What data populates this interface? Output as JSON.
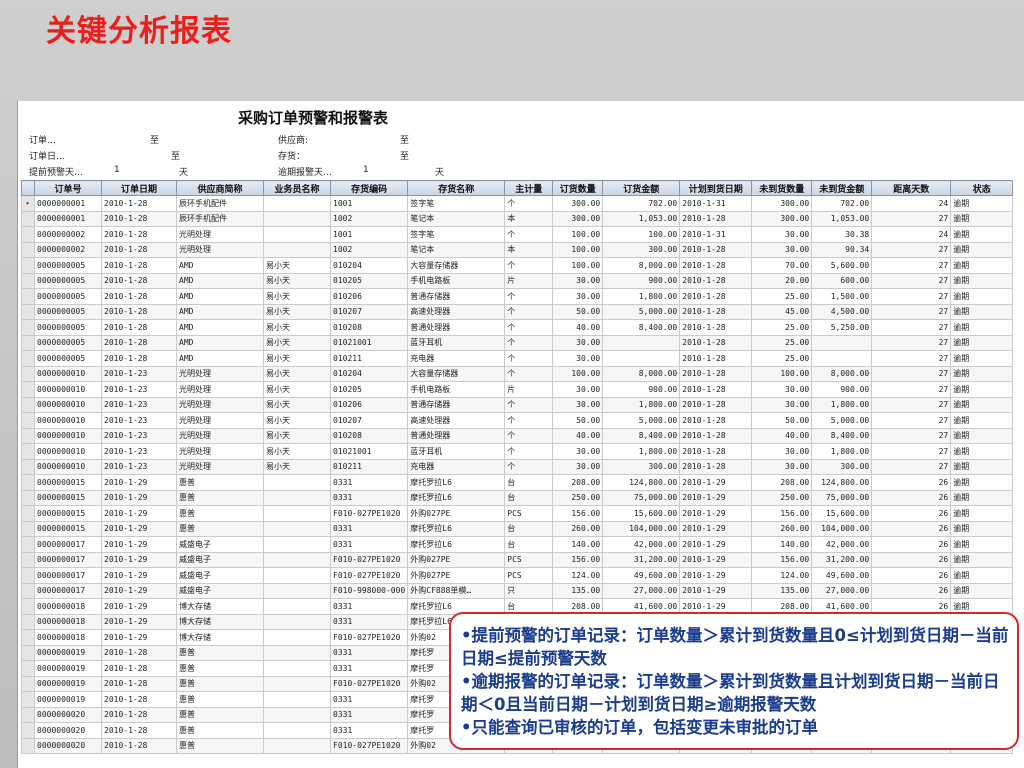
{
  "slide": {
    "title": "关键分析报表"
  },
  "report": {
    "title": "采购订单预警和报警表",
    "filters": {
      "order_no_label": "订单…",
      "order_no_to": "至",
      "supplier_label": "供应商:",
      "supplier_to": "至",
      "order_date_label": "订单日…",
      "order_date_to": "至",
      "inventory_label": "存货：",
      "inventory_to": "至",
      "advance_label": "提前预警天…",
      "advance_value": "1",
      "advance_unit": "天",
      "overdue_label": "逾期报警天…",
      "overdue_value": "1",
      "overdue_unit": "天"
    },
    "columns": [
      "",
      "订单号",
      "订单日期",
      "供应商简称",
      "业务员名称",
      "存货编码",
      "存货名称",
      "主计量",
      "订货数量",
      "订货金额",
      "计划到货日期",
      "未到货数量",
      "未到货金额",
      "距离天数",
      "状态"
    ],
    "rows": [
      [
        "▸",
        "0000000001",
        "2010-1-28",
        "辰环手机配件",
        "",
        "1001",
        "签字笔",
        "个",
        "300.00",
        "702.00",
        "2010-1-31",
        "300.00",
        "702.00",
        "24",
        "逾期"
      ],
      [
        "",
        "0000000001",
        "2010-1-28",
        "辰环手机配件",
        "",
        "1002",
        "笔记本",
        "本",
        "300.00",
        "1,053.00",
        "2010-1-28",
        "300.00",
        "1,053.00",
        "27",
        "逾期"
      ],
      [
        "",
        "0000000002",
        "2010-1-28",
        "光明处理",
        "",
        "1001",
        "签字笔",
        "个",
        "100.00",
        "100.00",
        "2010-1-31",
        "30.00",
        "30.38",
        "24",
        "逾期"
      ],
      [
        "",
        "0000000002",
        "2010-1-28",
        "光明处理",
        "",
        "1002",
        "笔记本",
        "本",
        "100.00",
        "300.00",
        "2010-1-28",
        "30.00",
        "90.34",
        "27",
        "逾期"
      ],
      [
        "",
        "0000000005",
        "2010-1-28",
        "AMD",
        "易小天",
        "010204",
        "大容量存储器",
        "个",
        "100.00",
        "8,000.00",
        "2010-1-28",
        "70.00",
        "5,600.00",
        "27",
        "逾期"
      ],
      [
        "",
        "0000000005",
        "2010-1-28",
        "AMD",
        "易小天",
        "010205",
        "手机电路板",
        "片",
        "30.00",
        "900.00",
        "2010-1-28",
        "20.00",
        "600.00",
        "27",
        "逾期"
      ],
      [
        "",
        "0000000005",
        "2010-1-28",
        "AMD",
        "易小天",
        "010206",
        "普通存储器",
        "个",
        "30.00",
        "1,800.00",
        "2010-1-28",
        "25.00",
        "1,500.00",
        "27",
        "逾期"
      ],
      [
        "",
        "0000000005",
        "2010-1-28",
        "AMD",
        "易小天",
        "010207",
        "高速处理器",
        "个",
        "50.00",
        "5,000.00",
        "2010-1-28",
        "45.00",
        "4,500.00",
        "27",
        "逾期"
      ],
      [
        "",
        "0000000005",
        "2010-1-28",
        "AMD",
        "易小天",
        "010208",
        "普通处理器",
        "个",
        "40.00",
        "8,400.00",
        "2010-1-28",
        "25.00",
        "5,250.00",
        "27",
        "逾期"
      ],
      [
        "",
        "0000000005",
        "2010-1-28",
        "AMD",
        "易小天",
        "01021001",
        "蓝牙耳机",
        "个",
        "30.00",
        "",
        "2010-1-28",
        "25.00",
        "",
        "27",
        "逾期"
      ],
      [
        "",
        "0000000005",
        "2010-1-28",
        "AMD",
        "易小天",
        "010211",
        "充电器",
        "个",
        "30.00",
        "",
        "2010-1-28",
        "25.00",
        "",
        "27",
        "逾期"
      ],
      [
        "",
        "0000000010",
        "2010-1-23",
        "光明处理",
        "易小天",
        "010204",
        "大容量存储器",
        "个",
        "100.00",
        "8,000.00",
        "2010-1-28",
        "100.00",
        "8,000.00",
        "27",
        "逾期"
      ],
      [
        "",
        "0000000010",
        "2010-1-23",
        "光明处理",
        "易小天",
        "010205",
        "手机电路板",
        "片",
        "30.00",
        "900.00",
        "2010-1-28",
        "30.00",
        "900.00",
        "27",
        "逾期"
      ],
      [
        "",
        "0000000010",
        "2010-1-23",
        "光明处理",
        "易小天",
        "010206",
        "普通存储器",
        "个",
        "30.00",
        "1,800.00",
        "2010-1-28",
        "30.00",
        "1,800.00",
        "27",
        "逾期"
      ],
      [
        "",
        "0000000010",
        "2010-1-23",
        "光明处理",
        "易小天",
        "010207",
        "高速处理器",
        "个",
        "50.00",
        "5,000.00",
        "2010-1-28",
        "50.00",
        "5,000.00",
        "27",
        "逾期"
      ],
      [
        "",
        "0000000010",
        "2010-1-23",
        "光明处理",
        "易小天",
        "010208",
        "普通处理器",
        "个",
        "40.00",
        "8,400.00",
        "2010-1-28",
        "40.00",
        "8,400.00",
        "27",
        "逾期"
      ],
      [
        "",
        "0000000010",
        "2010-1-23",
        "光明处理",
        "易小天",
        "01021001",
        "蓝牙耳机",
        "个",
        "30.00",
        "1,800.00",
        "2010-1-28",
        "30.00",
        "1,800.00",
        "27",
        "逾期"
      ],
      [
        "",
        "0000000010",
        "2010-1-23",
        "光明处理",
        "易小天",
        "010211",
        "充电器",
        "个",
        "30.00",
        "300.00",
        "2010-1-28",
        "30.00",
        "300.00",
        "27",
        "逾期"
      ],
      [
        "",
        "0000000015",
        "2010-1-29",
        "惠普",
        "",
        "0331",
        "摩托罗拉L6",
        "台",
        "208.00",
        "124,800.00",
        "2010-1-29",
        "208.00",
        "124,800.00",
        "26",
        "逾期"
      ],
      [
        "",
        "0000000015",
        "2010-1-29",
        "惠普",
        "",
        "0331",
        "摩托罗拉L6",
        "台",
        "250.00",
        "75,000.00",
        "2010-1-29",
        "250.00",
        "75,000.00",
        "26",
        "逾期"
      ],
      [
        "",
        "0000000015",
        "2010-1-29",
        "惠普",
        "",
        "F010-027PE1020",
        "外购027PE",
        "PCS",
        "156.00",
        "15,600.00",
        "2010-1-29",
        "156.00",
        "15,600.00",
        "26",
        "逾期"
      ],
      [
        "",
        "0000000015",
        "2010-1-29",
        "惠普",
        "",
        "0331",
        "摩托罗拉L6",
        "台",
        "260.00",
        "104,000.00",
        "2010-1-29",
        "260.00",
        "104,000.00",
        "26",
        "逾期"
      ],
      [
        "",
        "0000000017",
        "2010-1-29",
        "威盛电子",
        "",
        "0331",
        "摩托罗拉L6",
        "台",
        "140.00",
        "42,000.00",
        "2010-1-29",
        "140.00",
        "42,000.00",
        "26",
        "逾期"
      ],
      [
        "",
        "0000000017",
        "2010-1-29",
        "威盛电子",
        "",
        "F010-027PE1020",
        "外购027PE",
        "PCS",
        "156.00",
        "31,200.00",
        "2010-1-29",
        "156.00",
        "31,200.00",
        "26",
        "逾期"
      ],
      [
        "",
        "0000000017",
        "2010-1-29",
        "威盛电子",
        "",
        "F010-027PE1020",
        "外购027PE",
        "PCS",
        "124.00",
        "49,600.00",
        "2010-1-29",
        "124.00",
        "49,600.00",
        "26",
        "逾期"
      ],
      [
        "",
        "0000000017",
        "2010-1-29",
        "威盛电子",
        "",
        "F010-998000-000",
        "外购CF888单模…",
        "只",
        "135.00",
        "27,000.00",
        "2010-1-29",
        "135.00",
        "27,000.00",
        "26",
        "逾期"
      ],
      [
        "",
        "0000000018",
        "2010-1-29",
        "博大存储",
        "",
        "0331",
        "摩托罗拉L6",
        "台",
        "208.00",
        "41,600.00",
        "2010-1-29",
        "208.00",
        "41,600.00",
        "26",
        "逾期"
      ],
      [
        "",
        "0000000018",
        "2010-1-29",
        "博大存储",
        "",
        "0331",
        "摩托罗拉L6",
        "",
        "",
        "",
        "",
        "",
        "",
        "",
        ""
      ],
      [
        "",
        "0000000018",
        "2010-1-29",
        "博大存储",
        "",
        "F010-027PE1020",
        "外购02",
        "",
        "",
        "",
        "",
        "",
        "",
        "",
        ""
      ],
      [
        "",
        "0000000019",
        "2010-1-28",
        "惠普",
        "",
        "0331",
        "摩托罗",
        "",
        "",
        "",
        "",
        "",
        "",
        "",
        ""
      ],
      [
        "",
        "0000000019",
        "2010-1-28",
        "惠普",
        "",
        "0331",
        "摩托罗",
        "",
        "",
        "",
        "",
        "",
        "",
        "",
        ""
      ],
      [
        "",
        "0000000019",
        "2010-1-28",
        "惠普",
        "",
        "F010-027PE1020",
        "外购02",
        "",
        "",
        "",
        "",
        "",
        "",
        "",
        ""
      ],
      [
        "",
        "0000000019",
        "2010-1-28",
        "惠普",
        "",
        "0331",
        "摩托罗",
        "",
        "",
        "",
        "",
        "",
        "",
        "",
        ""
      ],
      [
        "",
        "0000000020",
        "2010-1-28",
        "惠普",
        "",
        "0331",
        "摩托罗",
        "",
        "",
        "",
        "",
        "",
        "",
        "",
        ""
      ],
      [
        "",
        "0000000020",
        "2010-1-28",
        "惠普",
        "",
        "0331",
        "摩托罗",
        "",
        "",
        "",
        "",
        "",
        "",
        "",
        ""
      ],
      [
        "",
        "0000000020",
        "2010-1-28",
        "惠普",
        "",
        "F010-027PE1020",
        "外购02",
        "",
        "",
        "",
        "",
        "",
        "",
        "",
        ""
      ]
    ]
  },
  "callout": {
    "line1": "•提前预警的订单记录：订单数量＞累计到货数量且0≤计划到货日期－当前日期≤提前预警天数",
    "line2": "•逾期报警的订单记录：订单数量＞累计到货数量且计划到货日期－当前日期＜0且当前日期－计划到货日期≥逾期报警天数",
    "line3": "•只能查询已审核的订单，包括变更未审批的订单"
  }
}
